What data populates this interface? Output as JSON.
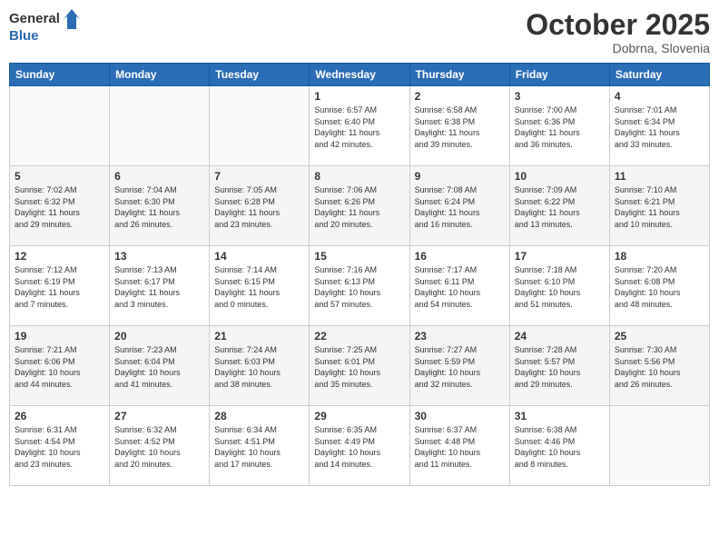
{
  "header": {
    "logo": {
      "text_general": "General",
      "text_blue": "Blue"
    },
    "month": "October 2025",
    "location": "Dobrna, Slovenia"
  },
  "weekdays": [
    "Sunday",
    "Monday",
    "Tuesday",
    "Wednesday",
    "Thursday",
    "Friday",
    "Saturday"
  ],
  "weeks": [
    [
      {
        "day": "",
        "info": ""
      },
      {
        "day": "",
        "info": ""
      },
      {
        "day": "",
        "info": ""
      },
      {
        "day": "1",
        "info": "Sunrise: 6:57 AM\nSunset: 6:40 PM\nDaylight: 11 hours\nand 42 minutes."
      },
      {
        "day": "2",
        "info": "Sunrise: 6:58 AM\nSunset: 6:38 PM\nDaylight: 11 hours\nand 39 minutes."
      },
      {
        "day": "3",
        "info": "Sunrise: 7:00 AM\nSunset: 6:36 PM\nDaylight: 11 hours\nand 36 minutes."
      },
      {
        "day": "4",
        "info": "Sunrise: 7:01 AM\nSunset: 6:34 PM\nDaylight: 11 hours\nand 33 minutes."
      }
    ],
    [
      {
        "day": "5",
        "info": "Sunrise: 7:02 AM\nSunset: 6:32 PM\nDaylight: 11 hours\nand 29 minutes."
      },
      {
        "day": "6",
        "info": "Sunrise: 7:04 AM\nSunset: 6:30 PM\nDaylight: 11 hours\nand 26 minutes."
      },
      {
        "day": "7",
        "info": "Sunrise: 7:05 AM\nSunset: 6:28 PM\nDaylight: 11 hours\nand 23 minutes."
      },
      {
        "day": "8",
        "info": "Sunrise: 7:06 AM\nSunset: 6:26 PM\nDaylight: 11 hours\nand 20 minutes."
      },
      {
        "day": "9",
        "info": "Sunrise: 7:08 AM\nSunset: 6:24 PM\nDaylight: 11 hours\nand 16 minutes."
      },
      {
        "day": "10",
        "info": "Sunrise: 7:09 AM\nSunset: 6:22 PM\nDaylight: 11 hours\nand 13 minutes."
      },
      {
        "day": "11",
        "info": "Sunrise: 7:10 AM\nSunset: 6:21 PM\nDaylight: 11 hours\nand 10 minutes."
      }
    ],
    [
      {
        "day": "12",
        "info": "Sunrise: 7:12 AM\nSunset: 6:19 PM\nDaylight: 11 hours\nand 7 minutes."
      },
      {
        "day": "13",
        "info": "Sunrise: 7:13 AM\nSunset: 6:17 PM\nDaylight: 11 hours\nand 3 minutes."
      },
      {
        "day": "14",
        "info": "Sunrise: 7:14 AM\nSunset: 6:15 PM\nDaylight: 11 hours\nand 0 minutes."
      },
      {
        "day": "15",
        "info": "Sunrise: 7:16 AM\nSunset: 6:13 PM\nDaylight: 10 hours\nand 57 minutes."
      },
      {
        "day": "16",
        "info": "Sunrise: 7:17 AM\nSunset: 6:11 PM\nDaylight: 10 hours\nand 54 minutes."
      },
      {
        "day": "17",
        "info": "Sunrise: 7:18 AM\nSunset: 6:10 PM\nDaylight: 10 hours\nand 51 minutes."
      },
      {
        "day": "18",
        "info": "Sunrise: 7:20 AM\nSunset: 6:08 PM\nDaylight: 10 hours\nand 48 minutes."
      }
    ],
    [
      {
        "day": "19",
        "info": "Sunrise: 7:21 AM\nSunset: 6:06 PM\nDaylight: 10 hours\nand 44 minutes."
      },
      {
        "day": "20",
        "info": "Sunrise: 7:23 AM\nSunset: 6:04 PM\nDaylight: 10 hours\nand 41 minutes."
      },
      {
        "day": "21",
        "info": "Sunrise: 7:24 AM\nSunset: 6:03 PM\nDaylight: 10 hours\nand 38 minutes."
      },
      {
        "day": "22",
        "info": "Sunrise: 7:25 AM\nSunset: 6:01 PM\nDaylight: 10 hours\nand 35 minutes."
      },
      {
        "day": "23",
        "info": "Sunrise: 7:27 AM\nSunset: 5:59 PM\nDaylight: 10 hours\nand 32 minutes."
      },
      {
        "day": "24",
        "info": "Sunrise: 7:28 AM\nSunset: 5:57 PM\nDaylight: 10 hours\nand 29 minutes."
      },
      {
        "day": "25",
        "info": "Sunrise: 7:30 AM\nSunset: 5:56 PM\nDaylight: 10 hours\nand 26 minutes."
      }
    ],
    [
      {
        "day": "26",
        "info": "Sunrise: 6:31 AM\nSunset: 4:54 PM\nDaylight: 10 hours\nand 23 minutes."
      },
      {
        "day": "27",
        "info": "Sunrise: 6:32 AM\nSunset: 4:52 PM\nDaylight: 10 hours\nand 20 minutes."
      },
      {
        "day": "28",
        "info": "Sunrise: 6:34 AM\nSunset: 4:51 PM\nDaylight: 10 hours\nand 17 minutes."
      },
      {
        "day": "29",
        "info": "Sunrise: 6:35 AM\nSunset: 4:49 PM\nDaylight: 10 hours\nand 14 minutes."
      },
      {
        "day": "30",
        "info": "Sunrise: 6:37 AM\nSunset: 4:48 PM\nDaylight: 10 hours\nand 11 minutes."
      },
      {
        "day": "31",
        "info": "Sunrise: 6:38 AM\nSunset: 4:46 PM\nDaylight: 10 hours\nand 8 minutes."
      },
      {
        "day": "",
        "info": ""
      }
    ]
  ]
}
